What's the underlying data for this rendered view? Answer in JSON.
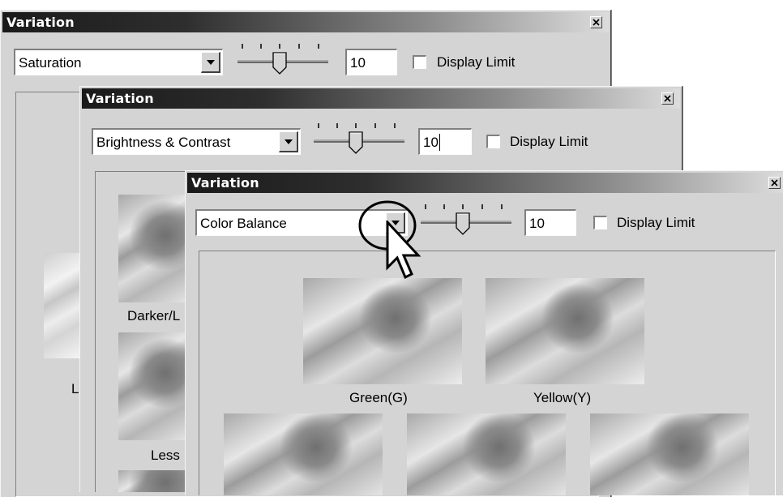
{
  "windows": [
    {
      "title": "Variation",
      "dropdown_value": "Saturation",
      "slider_value": "10",
      "display_limit_label": "Display Limit",
      "captions": [
        "L"
      ]
    },
    {
      "title": "Variation",
      "dropdown_value": "Brightness & Contrast",
      "slider_value": "10",
      "display_limit_label": "Display Limit",
      "captions": [
        "Darker/L",
        "Less"
      ]
    },
    {
      "title": "Variation",
      "dropdown_value": "Color Balance",
      "slider_value": "10",
      "display_limit_label": "Display Limit",
      "captions": [
        "Green(G)",
        "Yellow(Y)"
      ]
    }
  ],
  "icons": {
    "close": "close-icon",
    "dropdown": "chevron-down-icon",
    "cursor": "pointer-cursor-icon"
  },
  "colors": {
    "window_bg": "#d4d4d4",
    "titlebar_start": "#1a1a1a",
    "titlebar_end": "#dcdcdc"
  }
}
